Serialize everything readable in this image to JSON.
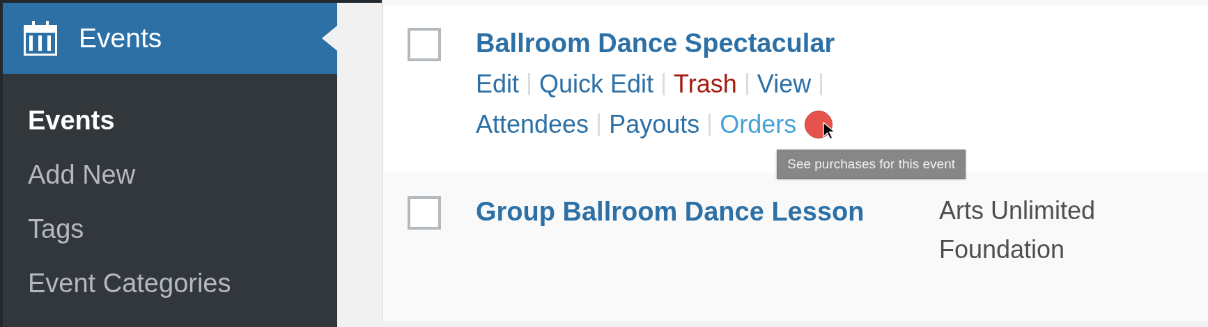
{
  "sidebar": {
    "menu_header": {
      "label": "Events",
      "selected": true
    },
    "submenu": [
      {
        "label": "Events",
        "selected": true
      },
      {
        "label": "Add New",
        "selected": false
      },
      {
        "label": "Tags",
        "selected": false
      },
      {
        "label": "Event Categories",
        "selected": false
      }
    ]
  },
  "rows": [
    {
      "title": "Ballroom Dance Spectacular",
      "checked": false,
      "actions": [
        {
          "label": "Edit",
          "kind": "normal",
          "hovered": false
        },
        {
          "label": "Quick Edit",
          "kind": "normal",
          "hovered": false
        },
        {
          "label": "Trash",
          "kind": "delete",
          "hovered": false
        },
        {
          "label": "View",
          "kind": "normal",
          "hovered": false
        },
        {
          "label": "Attendees",
          "kind": "normal",
          "hovered": false
        },
        {
          "label": "Payouts",
          "kind": "normal",
          "hovered": false
        },
        {
          "label": "Orders",
          "kind": "normal",
          "hovered": true
        }
      ]
    },
    {
      "title": "Group Ballroom Dance Lesson",
      "checked": false,
      "organizer": "Arts Unlimited Foundation"
    }
  ],
  "tooltip": {
    "text": "See purchases for this event"
  }
}
